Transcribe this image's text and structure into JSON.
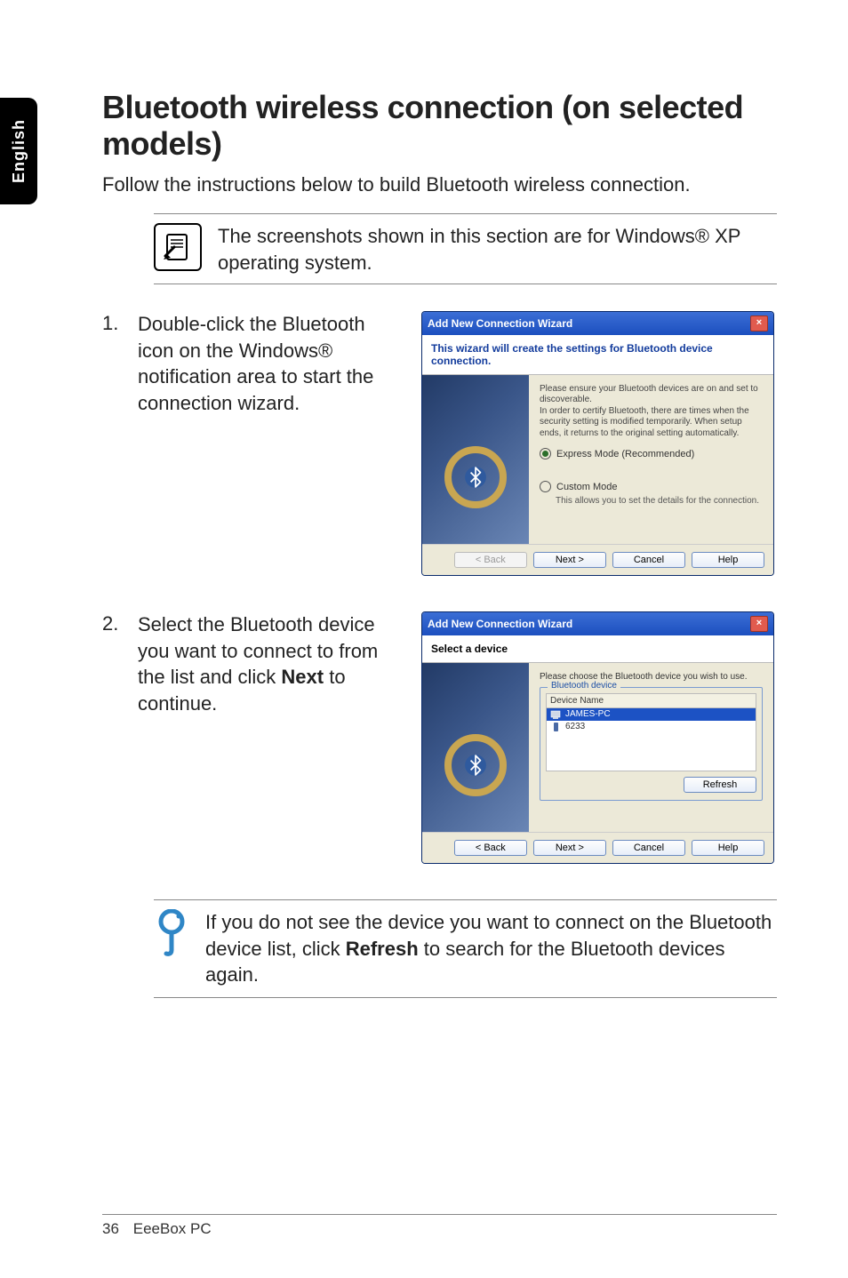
{
  "side_tab": "English",
  "heading": "Bluetooth wireless connection (on selected models)",
  "intro": "Follow the instructions below to build Bluetooth wireless connection.",
  "note": "The screenshots shown in this section are for Windows® XP operating system.",
  "steps": [
    {
      "num": "1.",
      "text": "Double-click the Bluetooth icon on the Windows® notification area to start the connection wizard."
    },
    {
      "num": "2.",
      "text_pre": "Select the Bluetooth device you want to connect to from the list and click ",
      "bold": "Next",
      "text_post": " to continue."
    }
  ],
  "dialog1": {
    "title": "Add New Connection Wizard",
    "banner": "This wizard will create the settings for Bluetooth device connection.",
    "desc": "Please ensure your Bluetooth devices are on and set to discoverable.\nIn order to certify Bluetooth, there are times when the security setting is modified temporarily. When setup ends, it returns to the original setting automatically.",
    "radio1": "Express Mode (Recommended)",
    "radio2": "Custom Mode",
    "radio2_sub": "This allows you to set the details for the connection.",
    "buttons": {
      "back": "< Back",
      "next": "Next >",
      "cancel": "Cancel",
      "help": "Help"
    }
  },
  "dialog2": {
    "title": "Add New Connection Wizard",
    "banner": "Select a device",
    "instruct": "Please choose the Bluetooth device you wish to use.",
    "group_title": "Bluetooth device",
    "col_header": "Device Name",
    "devices": [
      "JAMES-PC",
      "6233"
    ],
    "refresh": "Refresh",
    "buttons": {
      "back": "< Back",
      "next": "Next >",
      "cancel": "Cancel",
      "help": "Help"
    }
  },
  "tip_pre": "If you do not see the device you want to connect on the Bluetooth device list, click ",
  "tip_bold": "Refresh",
  "tip_post": " to search for the Bluetooth devices again.",
  "footer": {
    "page": "36",
    "product": "EeeBox PC"
  }
}
